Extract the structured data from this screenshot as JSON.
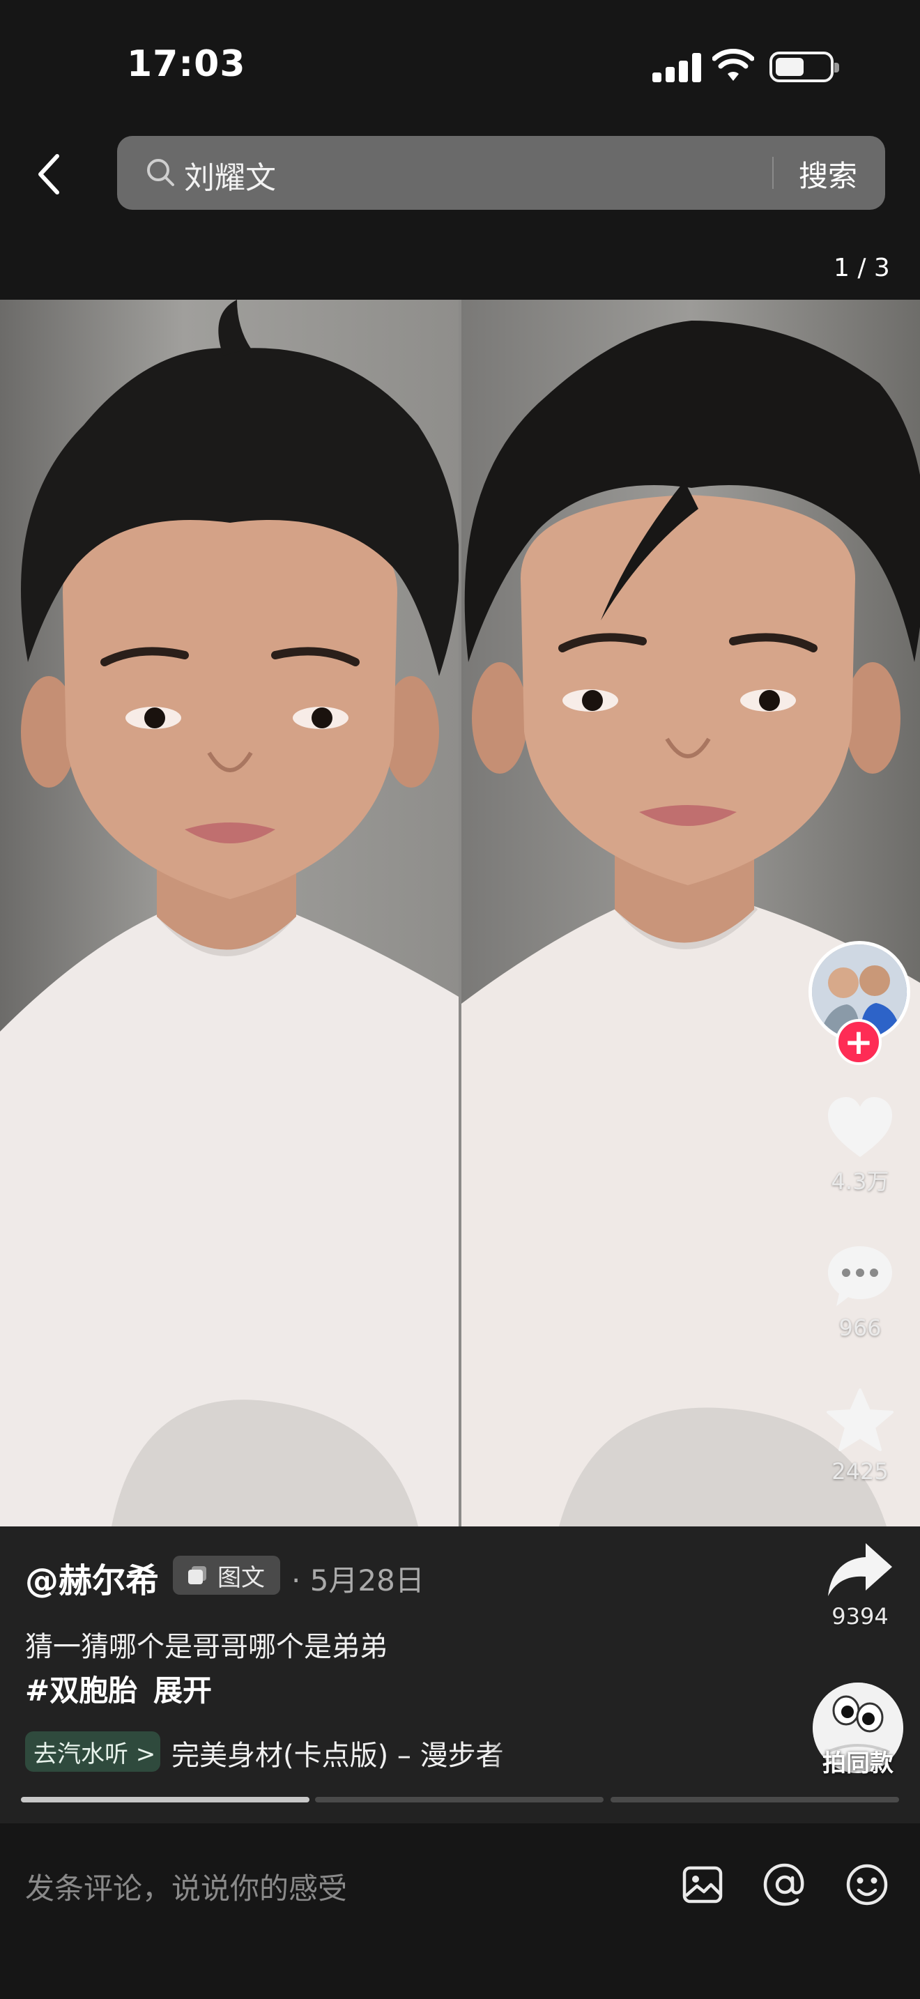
{
  "status_bar": {
    "time": "17:03"
  },
  "search": {
    "query": "刘耀文",
    "button_label": "搜索"
  },
  "page_indicator": "1 / 3",
  "actions": {
    "like_count": "4.3万",
    "comment_count": "966",
    "favorite_count": "2425",
    "share_count": "9394",
    "same_style_label": "拍同款"
  },
  "post": {
    "author": "@赫尔希",
    "type_tag": "图文",
    "date": "· 5月28日",
    "caption": "猜一猜哪个是哥哥哪个是弟弟",
    "hashtag": "#双胞胎",
    "expand_label": "展开"
  },
  "music": {
    "tag_label": "去汽水听 >",
    "title": "完美身材(卡点版) – 漫步者"
  },
  "carousel": {
    "current": 1,
    "total": 3
  },
  "comment_bar": {
    "placeholder": "发条评论，说说你的感受"
  },
  "colors": {
    "accent": "#fe2c55",
    "music_tag_bg": "#2f4a3d"
  }
}
